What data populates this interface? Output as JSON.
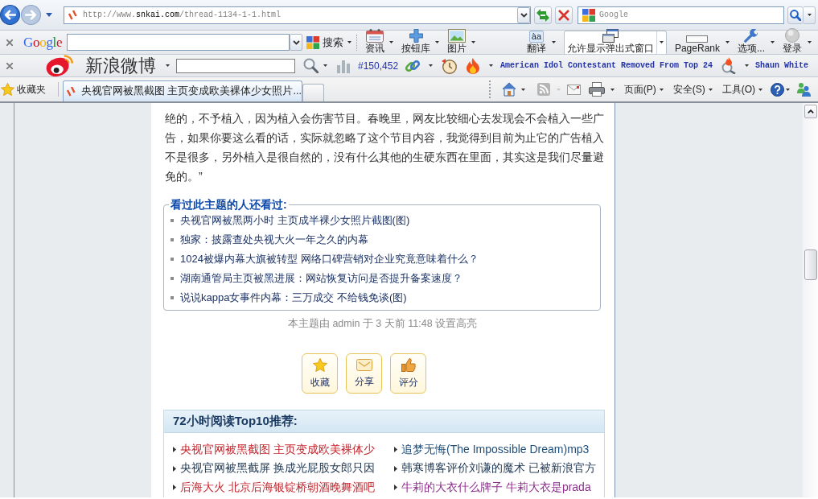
{
  "address_bar": {
    "url": "http://www.**snkai.com**/thread-1134-1-1.html",
    "search_placeholder": "Google"
  },
  "google_toolbar": {
    "logo": "Google",
    "search_label": "搜索",
    "buttons": [
      {
        "label": "资讯"
      },
      {
        "label": "按钮库"
      },
      {
        "label": "图片"
      }
    ],
    "tools": [
      {
        "label": "翻译",
        "kind": "plain",
        "glyph": "àa"
      },
      {
        "label": "允许显示弹出式窗口",
        "kind": "boxed"
      },
      {
        "label": "PageRank",
        "kind": "plain"
      },
      {
        "label": "选项...",
        "kind": "plain"
      },
      {
        "label": "登录",
        "kind": "plain"
      }
    ]
  },
  "weibo_toolbar": {
    "logo_text": "新浪微博",
    "count": "#150,452",
    "headline": "American Idol Contestant Removed From Top 24",
    "trend": "Shaun White"
  },
  "tab_row": {
    "favorites": "收藏夹",
    "tabs": [
      {
        "title": "央视官网被黑截图 主页变成欧美裸体少女照片...",
        "selected": true
      }
    ]
  },
  "command_bar": {
    "feeds_disabled": true,
    "menus": [
      "页面(P)",
      "安全(S)",
      "工具(O)"
    ]
  },
  "article": {
    "paragraph": "绝的，不予植入，因为植入会伤害节目。春晚里，网友比较细心去发现会不会植入一些广告，如果你要这么看的话，实际就忽略了这个节目内容，我觉得到目前为止它的广告植入不是很多，另外植入是很自然的，没有什么其他的生硬东西在里面，其实这是我们尽量避免的。”",
    "related": {
      "title": "看过此主题的人还看过:",
      "items": [
        "央视官网被黑两小时 主页成半裸少女照片截图(图)",
        "独家：披露查处央视大火一年之久的内幕",
        "1024被爆内幕大旗被转型 网络口碑营销对企业究竟意味着什么？",
        "湖南通管局主页被黑进展：网站恢复访问是否提升备案速度？",
        "说说kappa女事件内幕：三万成交 不给钱免谈(图)"
      ]
    },
    "highlight_note": "本主题由 admin 于 3 天前 11:48 设置高亮",
    "actions": [
      {
        "label": "收藏"
      },
      {
        "label": "分享"
      },
      {
        "label": "评分"
      }
    ]
  },
  "top10": {
    "title": "72小时阅读Top10推荐:",
    "columns": [
      {
        "items": [
          {
            "text": "央视官网被黑截图 主页变成欧美裸体少",
            "color": "#c4262e"
          },
          {
            "text": "央视官网被黑截屏 换成光屁股女郎只因",
            "color": "#1d3550"
          },
          {
            "text": "后海大火 北京后海银锭桥朝酒晚舞酒吧",
            "color": "#c4262e"
          }
        ]
      },
      {
        "items": [
          {
            "text": "追梦无悔(The Impossible Dream)mp3",
            "color": "#1f4e79"
          },
          {
            "text": "韩寒博客评价刘谦的魔术 已被新浪官方",
            "color": "#1d3550"
          },
          {
            "text": "牛莉的大衣什么牌子 牛莉大衣是prada",
            "color": "#8e2f8e"
          }
        ]
      }
    ]
  }
}
